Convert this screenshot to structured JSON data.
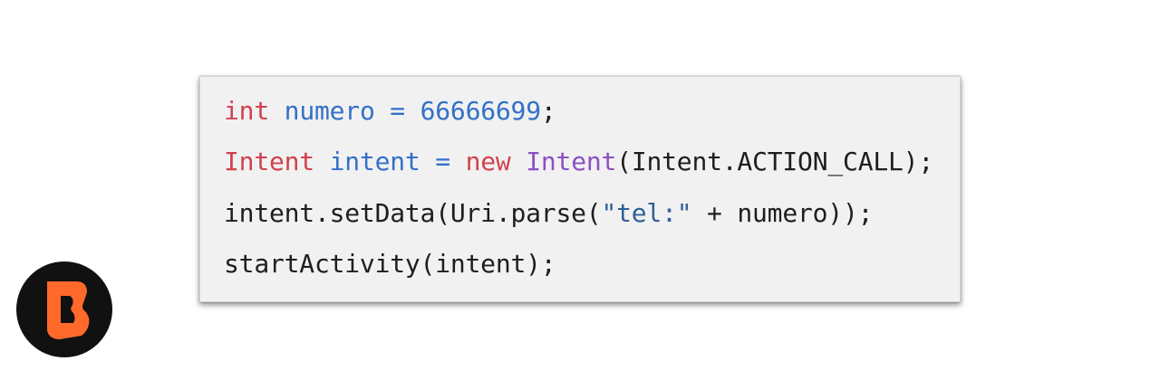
{
  "code_block": {
    "lines": [
      {
        "tokens": [
          {
            "text": "int",
            "kind": "keyword"
          },
          {
            "text": " ",
            "kind": "plain"
          },
          {
            "text": "numero",
            "kind": "variable"
          },
          {
            "text": " = ",
            "kind": "variable"
          },
          {
            "text": "66666699",
            "kind": "number"
          },
          {
            "text": ";",
            "kind": "plain"
          }
        ]
      },
      {
        "tokens": [
          {
            "text": "Intent",
            "kind": "keyword"
          },
          {
            "text": " ",
            "kind": "plain"
          },
          {
            "text": "intent",
            "kind": "variable"
          },
          {
            "text": " = ",
            "kind": "variable"
          },
          {
            "text": "new",
            "kind": "keyword"
          },
          {
            "text": " ",
            "kind": "plain"
          },
          {
            "text": "Intent",
            "kind": "type"
          },
          {
            "text": "(Intent.ACTION_CALL);",
            "kind": "plain"
          }
        ]
      },
      {
        "tokens": [
          {
            "text": "intent.setData(Uri.parse(",
            "kind": "plain"
          },
          {
            "text": "\"tel:\"",
            "kind": "string"
          },
          {
            "text": " + numero));",
            "kind": "plain"
          }
        ]
      },
      {
        "tokens": [
          {
            "text": "startActivity(intent);",
            "kind": "plain"
          }
        ]
      }
    ]
  },
  "logo": {
    "icon": "brand-b-logo-icon",
    "background_color": "#111111",
    "mark_color": "#ff6a2b"
  },
  "colors": {
    "keyword": "#d1414f",
    "variable": "#3370c8",
    "number": "#3370c8",
    "type": "#8d4fc4",
    "string": "#2f5f95",
    "plain": "#1e1e1e",
    "card_background": "#f1f1f1"
  }
}
